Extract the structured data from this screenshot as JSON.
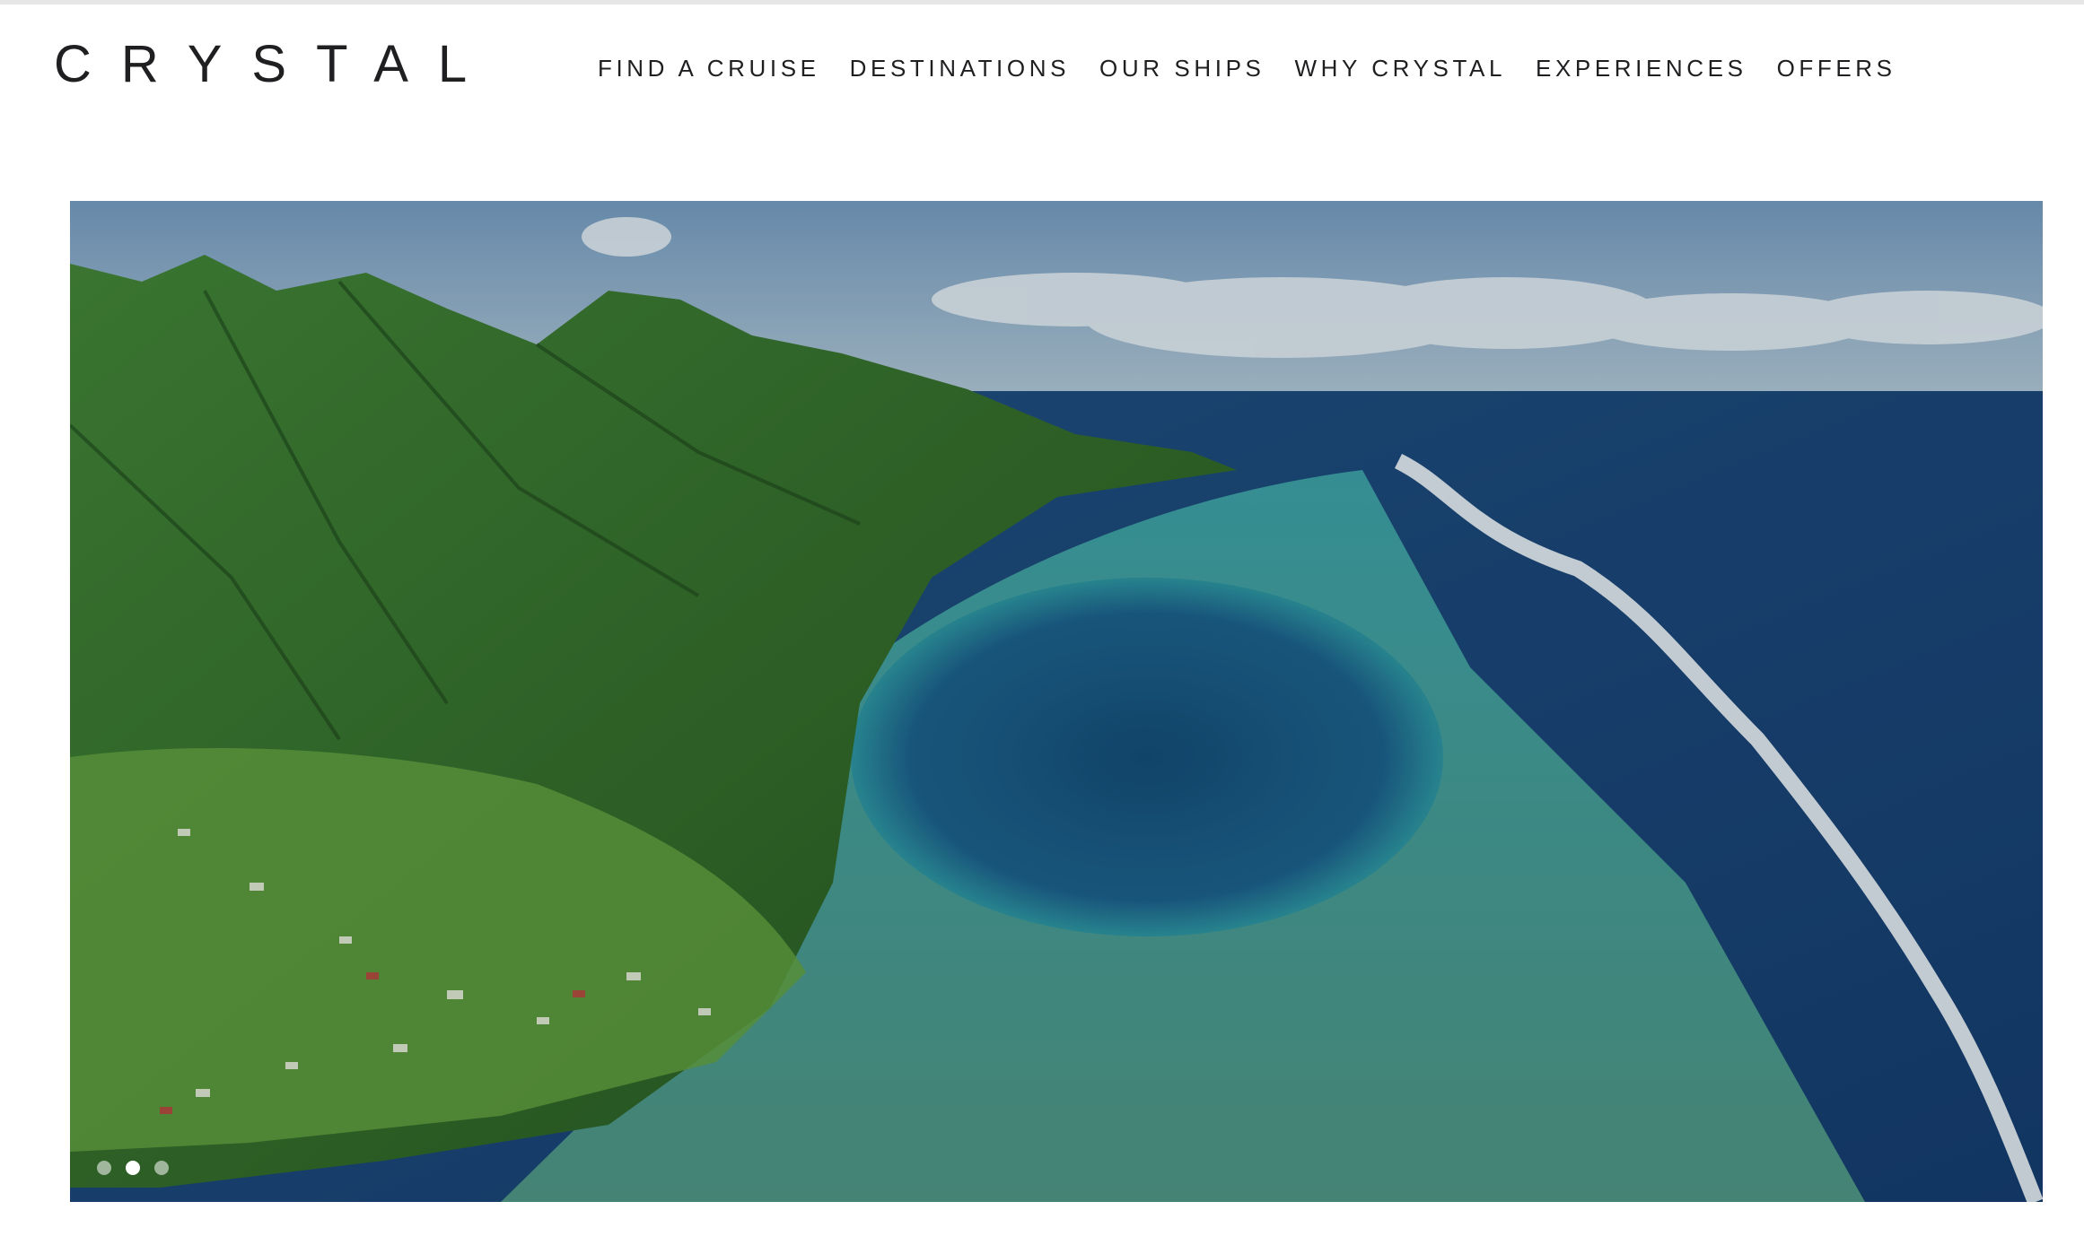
{
  "brand": {
    "logo_text": "CRYSTAL"
  },
  "nav": {
    "items": [
      {
        "label": "FIND A CRUISE"
      },
      {
        "label": "DESTINATIONS"
      },
      {
        "label": "OUR SHIPS"
      },
      {
        "label": "WHY CRYSTAL"
      },
      {
        "label": "EXPERIENCES"
      },
      {
        "label": "OFFERS"
      }
    ]
  },
  "hero": {
    "image_subject": "aerial view of green mountainous island coastline with turquoise lagoon and coral reef",
    "carousel": {
      "slide_count": 3,
      "active_index": 1
    }
  },
  "colors": {
    "text": "#1f1f22",
    "background": "#ffffff",
    "ocean_deep": "#173f73",
    "lagoon": "#2f8f96",
    "mountain_green": "#2e6a2a",
    "sky": "#8fb0c8"
  }
}
